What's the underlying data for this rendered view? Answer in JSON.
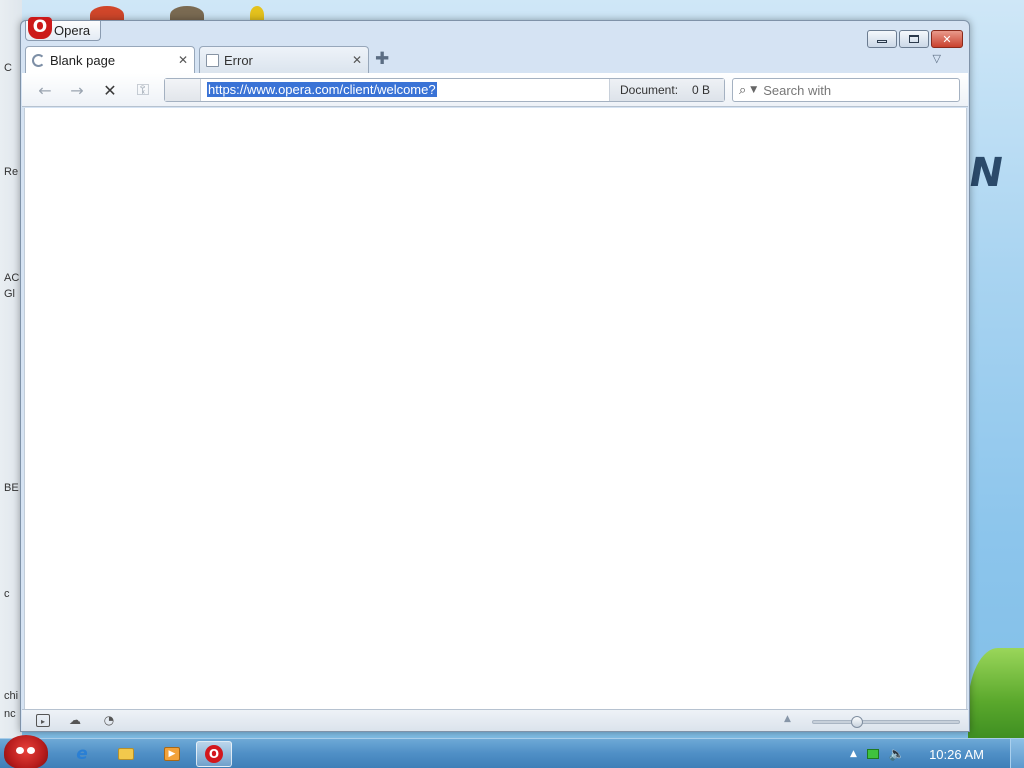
{
  "window": {
    "app_title": "Opera"
  },
  "tabs": [
    {
      "label": "Blank page",
      "active": true,
      "icon": "loading-icon"
    },
    {
      "label": "Error",
      "active": false,
      "icon": "document-icon"
    }
  ],
  "toolbar": {
    "back_icon": "←",
    "forward_icon": "→",
    "stop_icon": "✕",
    "key_icon": "⚿",
    "address_value": "https://www.opera.com/client/welcome?",
    "document_label": "Document:",
    "document_size": "0 B",
    "search_placeholder": "Search with",
    "search_icon": "⌕",
    "search_dropdown_icon": "▼"
  },
  "statusbar": {
    "panel_icon": "panel-toggle-icon",
    "unite_icon": "cloud-icon",
    "turbo_icon": "speed-icon",
    "zoom_fraction": 0.28
  },
  "taskbar": {
    "clock": "10:26 AM",
    "apps": [
      "internet-explorer",
      "windows-explorer",
      "media-player",
      "opera"
    ]
  },
  "desktop_labels": [
    "C",
    "Re",
    "AC",
    "Gl",
    "BE",
    "c",
    "chi",
    "nc"
  ],
  "colors": {
    "accent": "#3a73d6",
    "close_button": "#c9412d",
    "opera_red": "#cc1a1a"
  }
}
